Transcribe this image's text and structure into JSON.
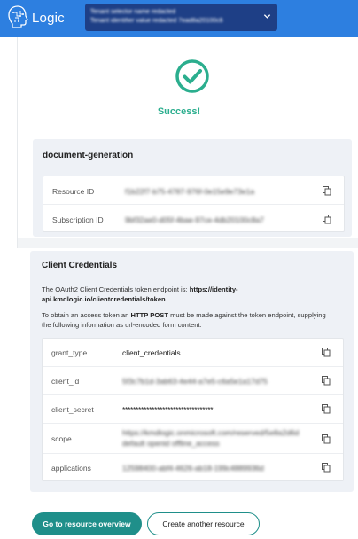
{
  "header": {
    "logo_text": "Logic",
    "tenant_line1": "Tenant selector name redacted",
    "tenant_line2": "Tenant identifier value redacted 7ead8a20100c8a7"
  },
  "status": {
    "message": "Success!"
  },
  "resource": {
    "title": "document-generation",
    "rows": [
      {
        "label": "Resource ID",
        "value": "f1b22f7-b75-4787-976f-0e15e9e73e1a"
      },
      {
        "label": "Subscription ID",
        "value": "9bf32ae0-d05f-4bae-97ce-4db20100c8a7"
      }
    ]
  },
  "credentials": {
    "title": "Client Credentials",
    "endpoint_prefix": "The OAuth2 Client Credentials token endpoint is: ",
    "endpoint_url_line1": "https://identity-",
    "endpoint_url_line2": "api.kmdlogic.io/clientcredentials/token",
    "post_prefix": "To obtain an access token an ",
    "post_bold": "HTTP POST",
    "post_suffix_line1": " must be made against the token endpoint, supplying",
    "post_line2": "the following information as url-encoded form content:",
    "rows": [
      {
        "label": "grant_type",
        "value": "client_credentials",
        "blurred": false
      },
      {
        "label": "client_id",
        "value": "5f3c7b1d-3ab63-4e44-a7e5-c6a5e1a17d75",
        "blurred": true
      },
      {
        "label": "client_secret",
        "value": "**********************************",
        "blurred": false
      },
      {
        "label": "scope",
        "value": "https://kmdlogic.onmicrosoft.com/reserved/5e8a2d6d",
        "value_line2": "default openid offline_access",
        "blurred": true
      },
      {
        "label": "applications",
        "value": "12598400-abf4-4626-ab18-199c4889936d",
        "blurred": true
      }
    ]
  },
  "actions": {
    "primary": "Go to resource overview",
    "secondary": "Create another resource"
  },
  "colors": {
    "brand_blue": "#2d7fe0",
    "tenant_select": "#1e3f86",
    "success_green": "#2bae8e",
    "button_teal": "#1f8f8a"
  }
}
